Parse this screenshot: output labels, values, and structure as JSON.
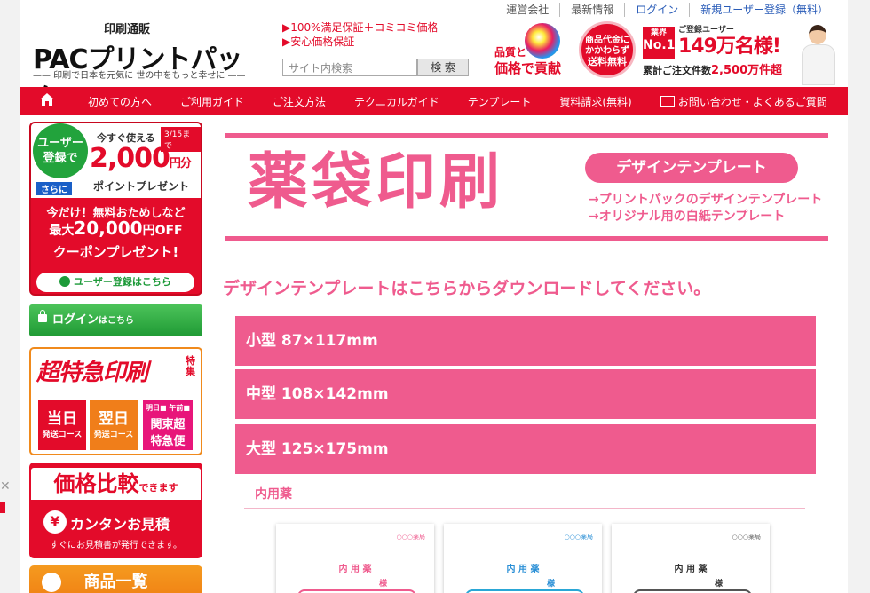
{
  "topnav": {
    "items": [
      {
        "label": "運営会社"
      },
      {
        "label": "最新情報"
      },
      {
        "label": "ログイン"
      },
      {
        "label": "新規ユーザー登録（無料）"
      }
    ]
  },
  "logo": {
    "sub": "印刷通販",
    "brand": "PAC",
    "name": "プリントパック",
    "tagline": "—— 印刷で日本を元気に 世の中をもっと幸せに ——"
  },
  "promo": {
    "line1": "▶100%満足保証＋コミコミ価格",
    "line2": "▶安心価格保証"
  },
  "search": {
    "placeholder": "サイト内検索",
    "button": "検 索"
  },
  "quality": {
    "line1": "品質と",
    "line2": "価格で貢献"
  },
  "freeship": {
    "l1": "商品代金に",
    "l2": "かかわらず",
    "l3": "送料無料"
  },
  "no1": {
    "badge_top": "業界",
    "badge_main": "No.1",
    "label": "ご登録ユーザー",
    "users": "149万名様!",
    "orders_label": "累計ご注文件数",
    "orders": "2,500万件超"
  },
  "mainnav": {
    "items": [
      {
        "label": "初めての方へ"
      },
      {
        "label": "ご利用ガイド"
      },
      {
        "label": "ご注文方法"
      },
      {
        "label": "テクニカルガイド"
      },
      {
        "label": "テンプレート"
      },
      {
        "label": "資料請求(無料)"
      },
      {
        "label": "お問い合わせ・よくあるご質問"
      }
    ]
  },
  "sidebar": {
    "user_banner": {
      "circle_l1": "ユーザー",
      "circle_l2": "登録で",
      "now": "今すぐ使える",
      "date": "3/15まで",
      "amount": "2,000",
      "unit": "円分",
      "points": "ポイントプレゼント",
      "sarani": "さらに",
      "mid1": "今だけ！無料おためしなど",
      "mid2_pre": "最大",
      "mid2_amt": "20,000",
      "mid2_post": "円OFF",
      "mid3": "クーポンプレゼント!",
      "register": "ユーザー登録はこちら"
    },
    "login": {
      "label": "ログイン",
      "suffix": "はこちら"
    },
    "express": {
      "title": "超特急印刷",
      "tokushu": "特集",
      "same_day": "当日",
      "same_day_sub": "発送コース",
      "next_day": "翌日",
      "next_day_sub": "発送コース",
      "kanto_top": "明日■ 午前■",
      "kanto_l1": "関東超",
      "kanto_l2": "特急便"
    },
    "price": {
      "title": "価格比較",
      "title_suffix": "できます",
      "yen": "¥",
      "quote": "カンタンお見積",
      "desc": "すぐにお見積書が発行できます。"
    },
    "products": {
      "label": "商品一覧"
    }
  },
  "hero": {
    "title": "薬袋印刷",
    "pill": "デザインテンプレート",
    "arrow1": "→プリントパックのデザインテンプレート",
    "arrow2": "→オリジナル用の白紙テンプレート"
  },
  "download_heading": "デザインテンプレートはこちらからダウンロードしてください。",
  "sizes": [
    {
      "label": "小型 87×117mm"
    },
    {
      "label": "中型 108×142mm"
    },
    {
      "label": "大型 125×175mm"
    }
  ],
  "section_title": "内用薬",
  "templates": [
    {
      "pharmacy": "○○○薬局",
      "name": "内 用 薬",
      "sama": "様",
      "color": "#ef5b8e"
    },
    {
      "pharmacy": "○○○薬局",
      "name": "内 用 薬",
      "sama": "様",
      "color": "#2a8fd6"
    },
    {
      "pharmacy": "○○○薬局",
      "name": "内 用 薬",
      "sama": "様",
      "color": "#333333"
    }
  ],
  "colors": {
    "accent_red": "#e30b2a",
    "accent_pink": "#ef5b8e",
    "login_green": "#1f9a34",
    "products_orange": "#f07e1a"
  }
}
